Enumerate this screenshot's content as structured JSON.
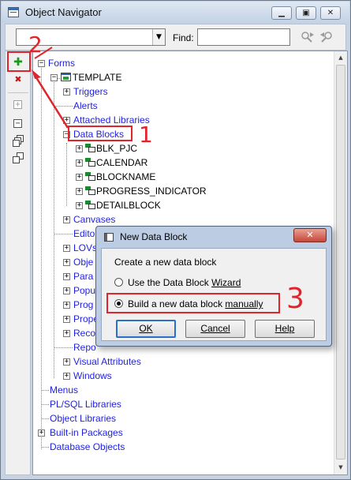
{
  "window": {
    "title": "Object Navigator",
    "controls": {
      "minimize": "▁",
      "restore": "▣",
      "close": "✕"
    }
  },
  "toolbar": {
    "context_value": "",
    "find_label": "Find:",
    "find_value": "",
    "find_next_icon": "search-forward-icon",
    "find_prev_icon": "search-backward-icon"
  },
  "vertical_toolbar": {
    "create": "✚",
    "delete": "✖",
    "expand": "+",
    "collapse": "−"
  },
  "tree": {
    "root": "Forms",
    "module": "TEMPLATE",
    "module_children": [
      "Triggers",
      "Alerts",
      "Attached Libraries",
      "Data Blocks"
    ],
    "data_blocks": [
      "BLK_PJC",
      "CALENDAR",
      "BLOCKNAME",
      "PROGRESS_INDICATOR",
      "DETAILBLOCK"
    ],
    "after_blocks": [
      "Canvases",
      "Edito",
      "LOVs",
      "Obje",
      "Para",
      "Popu",
      "Prog",
      "Prope",
      "Reco",
      "Repo",
      "Visual Attributes",
      "Windows"
    ],
    "top_level": [
      "Menus",
      "PL/SQL Libraries",
      "Object Libraries",
      "Built-in Packages",
      "Database Objects"
    ]
  },
  "dialog": {
    "title": "New Data Block",
    "close_label": "✕",
    "prompt": "Create a new data block",
    "option_wizard_prefix": "Use the Data Block ",
    "option_wizard_underlined": "Wizard",
    "option_manual_prefix": "Build a new data block ",
    "option_manual_underlined": "manually",
    "selected_option": "manual",
    "ok_label": "OK",
    "cancel_label": "Cancel",
    "help_label": "Help"
  },
  "annotations": {
    "step1": "1",
    "step2": "2",
    "step3": "3",
    "color": "#e0242c"
  },
  "colors": {
    "tree_text": "#1f1fe0",
    "accent": "#2a6fc9"
  }
}
